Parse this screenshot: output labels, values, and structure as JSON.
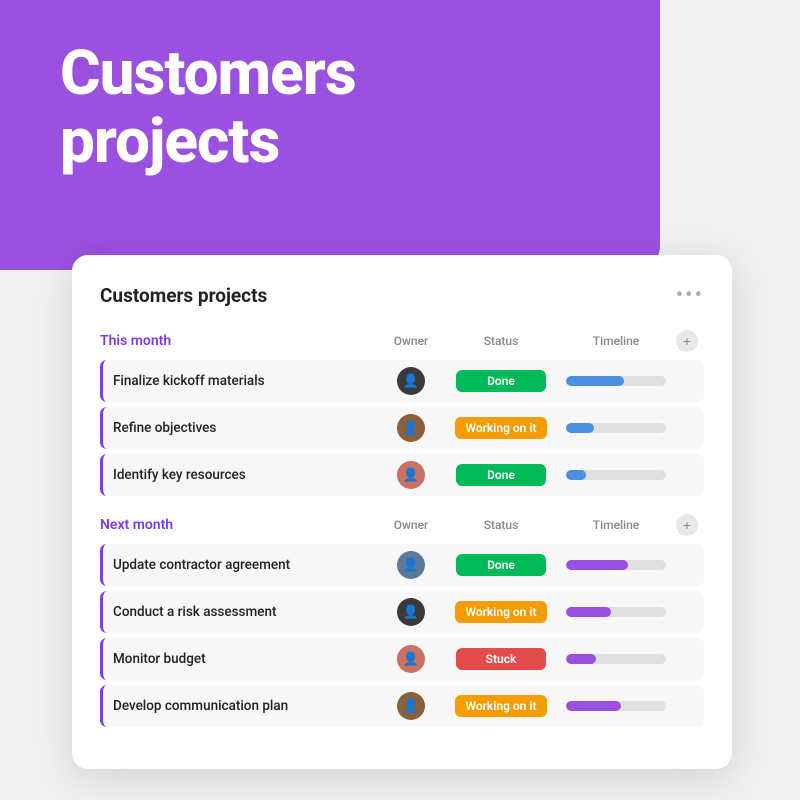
{
  "hero": {
    "title_line1": "Customers",
    "title_line2": "projects"
  },
  "card": {
    "title": "Customers projects",
    "more_label": "•••",
    "sections": [
      {
        "id": "this-month",
        "label": "This month",
        "col_owner": "Owner",
        "col_status": "Status",
        "col_timeline": "Timeline",
        "tasks": [
          {
            "name": "Finalize kickoff materials",
            "avatar_text": "👤",
            "avatar_class": "avatar-1",
            "status": "Done",
            "status_class": "status-done",
            "timeline_pct": 58,
            "timeline_class": "fill-blue"
          },
          {
            "name": "Refine objectives",
            "avatar_text": "👤",
            "avatar_class": "avatar-2",
            "status": "Working on it",
            "status_class": "status-working",
            "timeline_pct": 28,
            "timeline_class": "fill-blue-sm"
          },
          {
            "name": "Identify key resources",
            "avatar_text": "👤",
            "avatar_class": "avatar-3",
            "status": "Done",
            "status_class": "status-done",
            "timeline_pct": 20,
            "timeline_class": "fill-blue-sm"
          }
        ]
      },
      {
        "id": "next-month",
        "label": "Next month",
        "col_owner": "Owner",
        "col_status": "Status",
        "col_timeline": "Timeline",
        "tasks": [
          {
            "name": "Update contractor agreement",
            "avatar_text": "👤",
            "avatar_class": "avatar-4",
            "status": "Done",
            "status_class": "status-done",
            "timeline_pct": 62,
            "timeline_class": "fill-purple"
          },
          {
            "name": "Conduct a risk assessment",
            "avatar_text": "👤",
            "avatar_class": "avatar-1",
            "status": "Working on it",
            "status_class": "status-working",
            "timeline_pct": 45,
            "timeline_class": "fill-purple"
          },
          {
            "name": "Monitor budget",
            "avatar_text": "👤",
            "avatar_class": "avatar-3",
            "status": "Stuck",
            "status_class": "status-stuck",
            "timeline_pct": 30,
            "timeline_class": "fill-purple"
          },
          {
            "name": "Develop communication plan",
            "avatar_text": "👤",
            "avatar_class": "avatar-2",
            "status": "Working on it",
            "status_class": "status-working",
            "timeline_pct": 55,
            "timeline_class": "fill-purple"
          }
        ]
      }
    ]
  }
}
